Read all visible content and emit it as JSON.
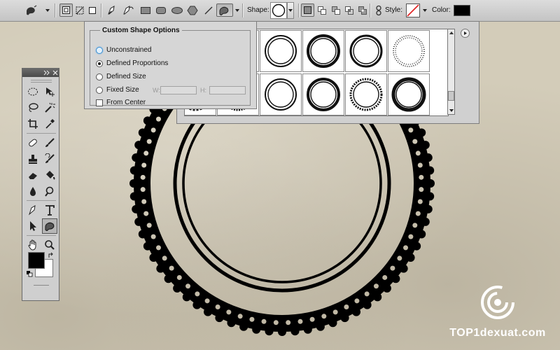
{
  "options_bar": {
    "shape_label": "Shape:",
    "style_label": "Style:",
    "color_label": "Color:",
    "color_value": "#000000",
    "tool_icons": [
      "custom-shape-preset-icon",
      "shape-layers-icon",
      "paths-icon",
      "fill-pixels-icon",
      "pen-icon",
      "freeform-pen-icon",
      "rectangle-icon",
      "rounded-rectangle-icon",
      "ellipse-icon",
      "polygon-icon",
      "line-icon",
      "custom-shape-icon"
    ],
    "mode_icons": [
      "new-layer-mode-icon",
      "add-to-area-icon",
      "subtract-area-icon",
      "intersect-area-icon",
      "exclude-overlap-icon",
      "link-icon"
    ]
  },
  "custom_shape_options": {
    "title": "Custom Shape Options",
    "options": [
      {
        "label": "Unconstrained",
        "selected": false
      },
      {
        "label": "Defined Proportions",
        "selected": true
      },
      {
        "label": "Defined Size",
        "selected": false
      },
      {
        "label": "Fixed Size",
        "selected": false
      }
    ],
    "width_label": "W:",
    "height_label": "H:",
    "from_center_label": "From Center",
    "from_center_checked": false
  },
  "tools_panel": {
    "tools": [
      "marquee-tool-icon",
      "move-tool-icon",
      "lasso-tool-icon",
      "magic-wand-icon",
      "crop-tool-icon",
      "eyedropper-icon",
      "healing-brush-icon",
      "brush-tool-icon",
      "clone-stamp-icon",
      "history-brush-icon",
      "eraser-icon",
      "paint-bucket-icon",
      "blur-tool-icon",
      "dodge-tool-icon",
      "pen-tool-icon",
      "type-tool-icon",
      "path-selection-icon",
      "custom-shape-tool-icon",
      "hand-tool-icon",
      "zoom-tool-icon"
    ],
    "foreground_color": "#000000",
    "background_color": "#ffffff"
  },
  "watermark": {
    "text": "TOP1dexuat.com"
  }
}
